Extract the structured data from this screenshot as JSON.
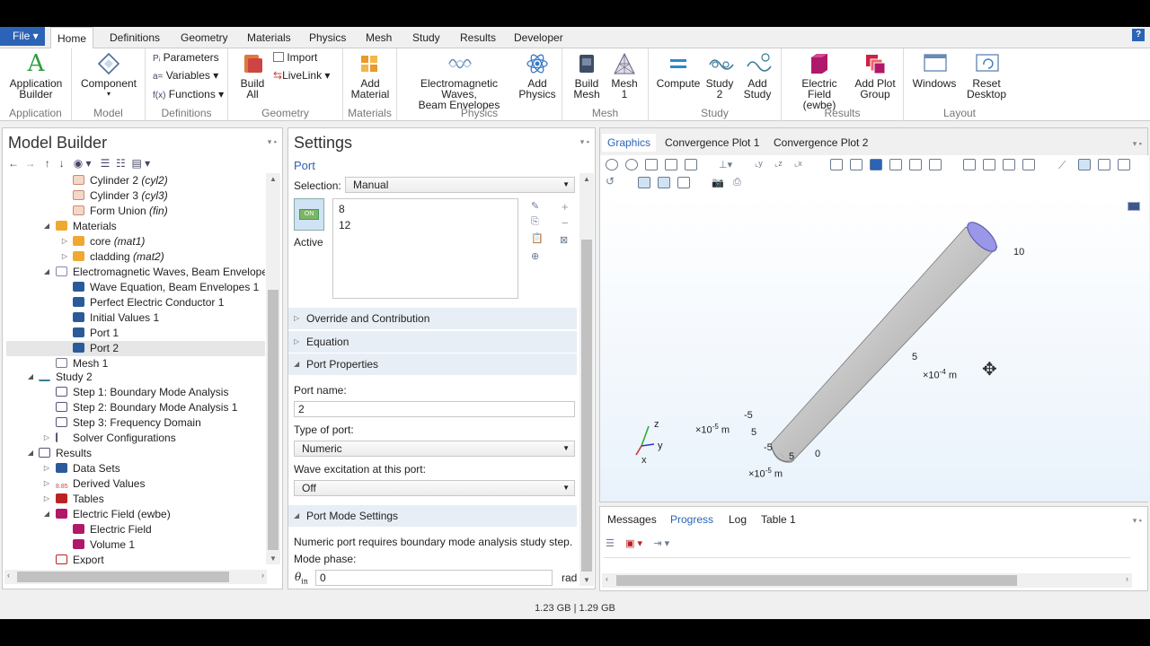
{
  "menu": {
    "file": "File",
    "tabs": [
      "Home",
      "Definitions",
      "Geometry",
      "Materials",
      "Physics",
      "Mesh",
      "Study",
      "Results",
      "Developer"
    ],
    "help": "?"
  },
  "ribbon": {
    "app_builder": "Application\nBuilder",
    "component": "Component",
    "parameters": "Parameters",
    "variables": "Variables",
    "functions": "Functions",
    "build_all": "Build\nAll",
    "import": "Import",
    "livelink": "LiveLink",
    "add_material": "Add\nMaterial",
    "em_waves": "Electromagnetic Waves,\nBeam Envelopes",
    "add_physics": "Add\nPhysics",
    "build_mesh": "Build\nMesh",
    "mesh1": "Mesh\n1",
    "compute": "Compute",
    "study2": "Study\n2",
    "add_study": "Add\nStudy",
    "electric_field": "Electric Field\n(ewbe)",
    "add_plot_group": "Add Plot\nGroup",
    "windows": "Windows",
    "reset_desktop": "Reset\nDesktop",
    "groups": [
      "Application",
      "Model",
      "Definitions",
      "Geometry",
      "Materials",
      "Physics",
      "Mesh",
      "Study",
      "Results",
      "Layout"
    ]
  },
  "model_builder": {
    "title": "Model Builder",
    "items": [
      {
        "label": "Cylinder 2",
        "tag": "(cyl2)"
      },
      {
        "label": "Cylinder 3",
        "tag": "(cyl3)"
      },
      {
        "label": "Form Union",
        "tag": "(fin)"
      },
      {
        "label": "Materials",
        "tag": ""
      },
      {
        "label": "core",
        "tag": "(mat1)"
      },
      {
        "label": "cladding",
        "tag": "(mat2)"
      },
      {
        "label": "Electromagnetic Waves, Beam Envelopes",
        "tag": "("
      },
      {
        "label": "Wave Equation, Beam Envelopes 1",
        "tag": ""
      },
      {
        "label": "Perfect Electric Conductor 1",
        "tag": ""
      },
      {
        "label": "Initial Values 1",
        "tag": ""
      },
      {
        "label": "Port 1",
        "tag": ""
      },
      {
        "label": "Port 2",
        "tag": ""
      },
      {
        "label": "Mesh 1",
        "tag": ""
      },
      {
        "label": "Study 2",
        "tag": ""
      },
      {
        "label": "Step 1: Boundary Mode Analysis",
        "tag": ""
      },
      {
        "label": "Step 2: Boundary Mode Analysis 1",
        "tag": ""
      },
      {
        "label": "Step 3: Frequency Domain",
        "tag": ""
      },
      {
        "label": "Solver Configurations",
        "tag": ""
      },
      {
        "label": "Results",
        "tag": ""
      },
      {
        "label": "Data Sets",
        "tag": ""
      },
      {
        "label": "Derived Values",
        "tag": ""
      },
      {
        "label": "Tables",
        "tag": ""
      },
      {
        "label": "Electric Field (ewbe)",
        "tag": ""
      },
      {
        "label": "Electric Field",
        "tag": ""
      },
      {
        "label": "Volume 1",
        "tag": ""
      },
      {
        "label": "Export",
        "tag": ""
      }
    ]
  },
  "settings": {
    "title": "Settings",
    "subtitle": "Port",
    "selection_label": "Selection:",
    "selection_value": "Manual",
    "boundaries": [
      "8",
      "12"
    ],
    "active_label": "Active",
    "on_badge": "ON",
    "sections": {
      "override": "Override and Contribution",
      "equation": "Equation",
      "port_properties": "Port Properties",
      "port_mode": "Port Mode Settings"
    },
    "port_name_label": "Port name:",
    "port_name_value": "2",
    "type_label": "Type of port:",
    "type_value": "Numeric",
    "wave_label": "Wave excitation at this port:",
    "wave_value": "Off",
    "note": "Numeric port requires boundary mode analysis study step.",
    "mode_phase_label": "Mode phase:",
    "theta_symbol": "θ",
    "theta_sub": "in",
    "mode_phase_value": "0",
    "mode_phase_unit": "rad"
  },
  "graphics": {
    "tabs": [
      "Graphics",
      "Convergence Plot 1",
      "Convergence Plot 2"
    ],
    "axis_labels": {
      "ten": "10",
      "five_a": "5",
      "exp_m4": "×10",
      "exp_m4_sup": "-4",
      "unit_m": "m",
      "neg5_a": "-5",
      "exp_m5_a": "×10",
      "exp_m5_a_sup": "-5",
      "five_b": "5",
      "neg5_b": "-5",
      "five_c": "5",
      "zero": "0",
      "exp_m5_b": "×10",
      "exp_m5_b_sup": "-5"
    },
    "triad": {
      "z": "z",
      "y": "y",
      "x": "x"
    }
  },
  "bottom": {
    "tabs": [
      "Messages",
      "Progress",
      "Log",
      "Table 1"
    ]
  },
  "status": {
    "memory": "1.23 GB | 1.29 GB"
  }
}
